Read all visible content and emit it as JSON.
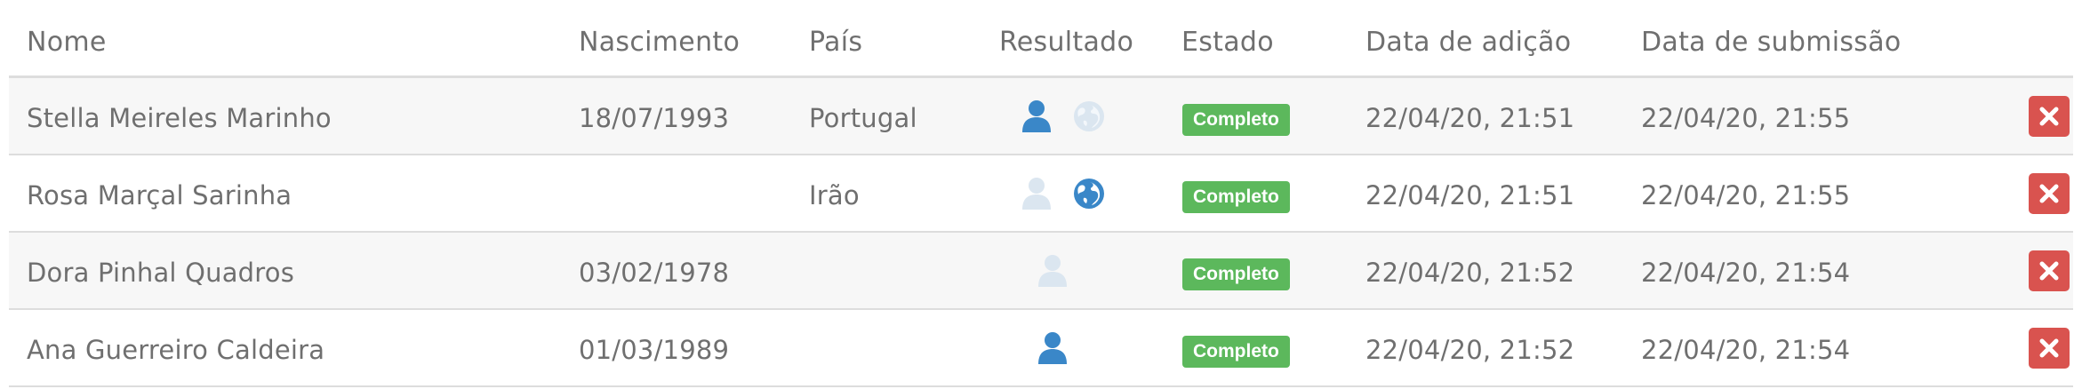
{
  "headers": {
    "nome": "Nome",
    "nascimento": "Nascimento",
    "pais": "País",
    "resultado": "Resultado",
    "estado": "Estado",
    "data_adicao": "Data de adição",
    "data_submissao": "Data de submissão"
  },
  "colors": {
    "accent_blue": "#3a87c8",
    "faded_icon": "#dbe6f0",
    "badge_green": "#5cb85c",
    "delete_red": "#d9534f"
  },
  "rows": [
    {
      "nome": "Stella Meireles Marinho",
      "nascimento": "18/07/1993",
      "pais": "Portugal",
      "person_icon": "active",
      "globe_icon": "faded",
      "estado": "Completo",
      "data_adicao": "22/04/20, 21:51",
      "data_submissao": "22/04/20, 21:55"
    },
    {
      "nome": "Rosa Marçal Sarinha",
      "nascimento": "",
      "pais": "Irão",
      "person_icon": "faded",
      "globe_icon": "active",
      "estado": "Completo",
      "data_adicao": "22/04/20, 21:51",
      "data_submissao": "22/04/20, 21:55"
    },
    {
      "nome": "Dora Pinhal Quadros",
      "nascimento": "03/02/1978",
      "pais": "",
      "person_icon": "faded",
      "globe_icon": "none",
      "estado": "Completo",
      "data_adicao": "22/04/20, 21:52",
      "data_submissao": "22/04/20, 21:54"
    },
    {
      "nome": "Ana Guerreiro Caldeira",
      "nascimento": "01/03/1989",
      "pais": "",
      "person_icon": "active",
      "globe_icon": "none",
      "estado": "Completo",
      "data_adicao": "22/04/20, 21:52",
      "data_submissao": "22/04/20, 21:54"
    }
  ]
}
